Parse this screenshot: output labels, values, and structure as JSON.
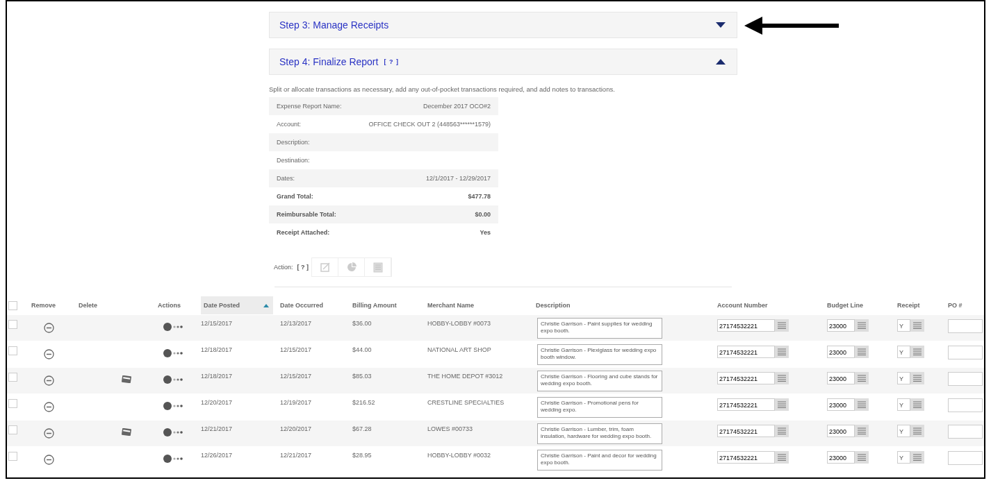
{
  "steps": [
    {
      "title": "Step 3: Manage Receipts",
      "expanded": false
    },
    {
      "title": "Step 4: Finalize Report",
      "help": "[ ? ]",
      "expanded": true
    }
  ],
  "instructions": "Split or allocate transactions as necessary, add any out-of-pocket transactions required, and add notes to transactions.",
  "summary": [
    {
      "label": "Expense Report Name:",
      "value": "December 2017 OCO#2",
      "bold": false
    },
    {
      "label": "Account:",
      "value": "OFFICE CHECK OUT 2 (448563******1579)",
      "bold": false
    },
    {
      "label": "Description:",
      "bold": false
    },
    {
      "label": "Destination:",
      "bold": false
    },
    {
      "label": "Dates:",
      "value": "12/1/2017 - 12/29/2017",
      "bold": false
    },
    {
      "label": "Grand Total:",
      "value": "$477.78",
      "bold": true
    },
    {
      "label": "Reimbursable Total:",
      "value": "$0.00",
      "bold": true
    },
    {
      "label": "Receipt Attached:",
      "value": "Yes",
      "bold": true
    }
  ],
  "action": {
    "label": "Action:",
    "help": "[ ? ]"
  },
  "table": {
    "all_checked": false,
    "columns": [
      {
        "label": "Remove",
        "sorted": false
      },
      {
        "label": "Delete",
        "sorted": false
      },
      {
        "label": "Actions",
        "sorted": false
      },
      {
        "label": "Date Posted",
        "sorted": true
      },
      {
        "label": "Date Occurred",
        "sorted": false
      },
      {
        "label": "Billing Amount",
        "sorted": false
      },
      {
        "label": "Merchant Name",
        "sorted": false
      },
      {
        "label": "Description",
        "sorted": false
      },
      {
        "label": "Account Number",
        "sorted": false
      },
      {
        "label": "Budget Line",
        "sorted": false
      },
      {
        "label": "Receipt",
        "sorted": false
      },
      {
        "label": "PO #",
        "sorted": false
      }
    ],
    "rows": [
      {
        "checked": false,
        "card": false,
        "date_posted": "12/15/2017",
        "date_occurred": "12/13/2017",
        "amount": "$36.00",
        "merchant": "HOBBY-LOBBY #0073",
        "description": "Christie Garrison - Paint supplies for wedding expo booth.",
        "account": "27174532221",
        "budget": "23000",
        "receipt": "Y"
      },
      {
        "checked": false,
        "card": false,
        "date_posted": "12/18/2017",
        "date_occurred": "12/15/2017",
        "amount": "$44.00",
        "merchant": "NATIONAL ART SHOP",
        "description": "Christie Garrison - Plexiglass for wedding expo booth window.",
        "account": "27174532221",
        "budget": "23000",
        "receipt": "Y"
      },
      {
        "checked": false,
        "card": true,
        "date_posted": "12/18/2017",
        "date_occurred": "12/15/2017",
        "amount": "$85.03",
        "merchant": "THE HOME DEPOT #3012",
        "description": "Christie Garrison - Flooring and cube stands for wedding expo booth.",
        "account": "27174532221",
        "budget": "23000",
        "receipt": "Y"
      },
      {
        "checked": false,
        "card": false,
        "date_posted": "12/20/2017",
        "date_occurred": "12/19/2017",
        "amount": "$216.52",
        "merchant": "CRESTLINE SPECIALTIES",
        "description": "Christie Garrison - Promotional pens for wedding expo.",
        "account": "27174532221",
        "budget": "23000",
        "receipt": "Y"
      },
      {
        "checked": false,
        "card": true,
        "date_posted": "12/21/2017",
        "date_occurred": "12/20/2017",
        "amount": "$67.28",
        "merchant": "LOWES #00733",
        "description": "Christie Garrison - Lumber, trim, foam insulation, hardware for wedding expo booth.",
        "account": "27174532221",
        "budget": "23000",
        "receipt": "Y"
      },
      {
        "checked": false,
        "card": false,
        "date_posted": "12/26/2017",
        "date_occurred": "12/21/2017",
        "amount": "$28.95",
        "merchant": "HOBBY-LOBBY #0032",
        "description": "Christie Garrison - Paint and decor for wedding expo booth.",
        "account": "27174532221",
        "budget": "23000",
        "receipt": "Y"
      }
    ]
  }
}
